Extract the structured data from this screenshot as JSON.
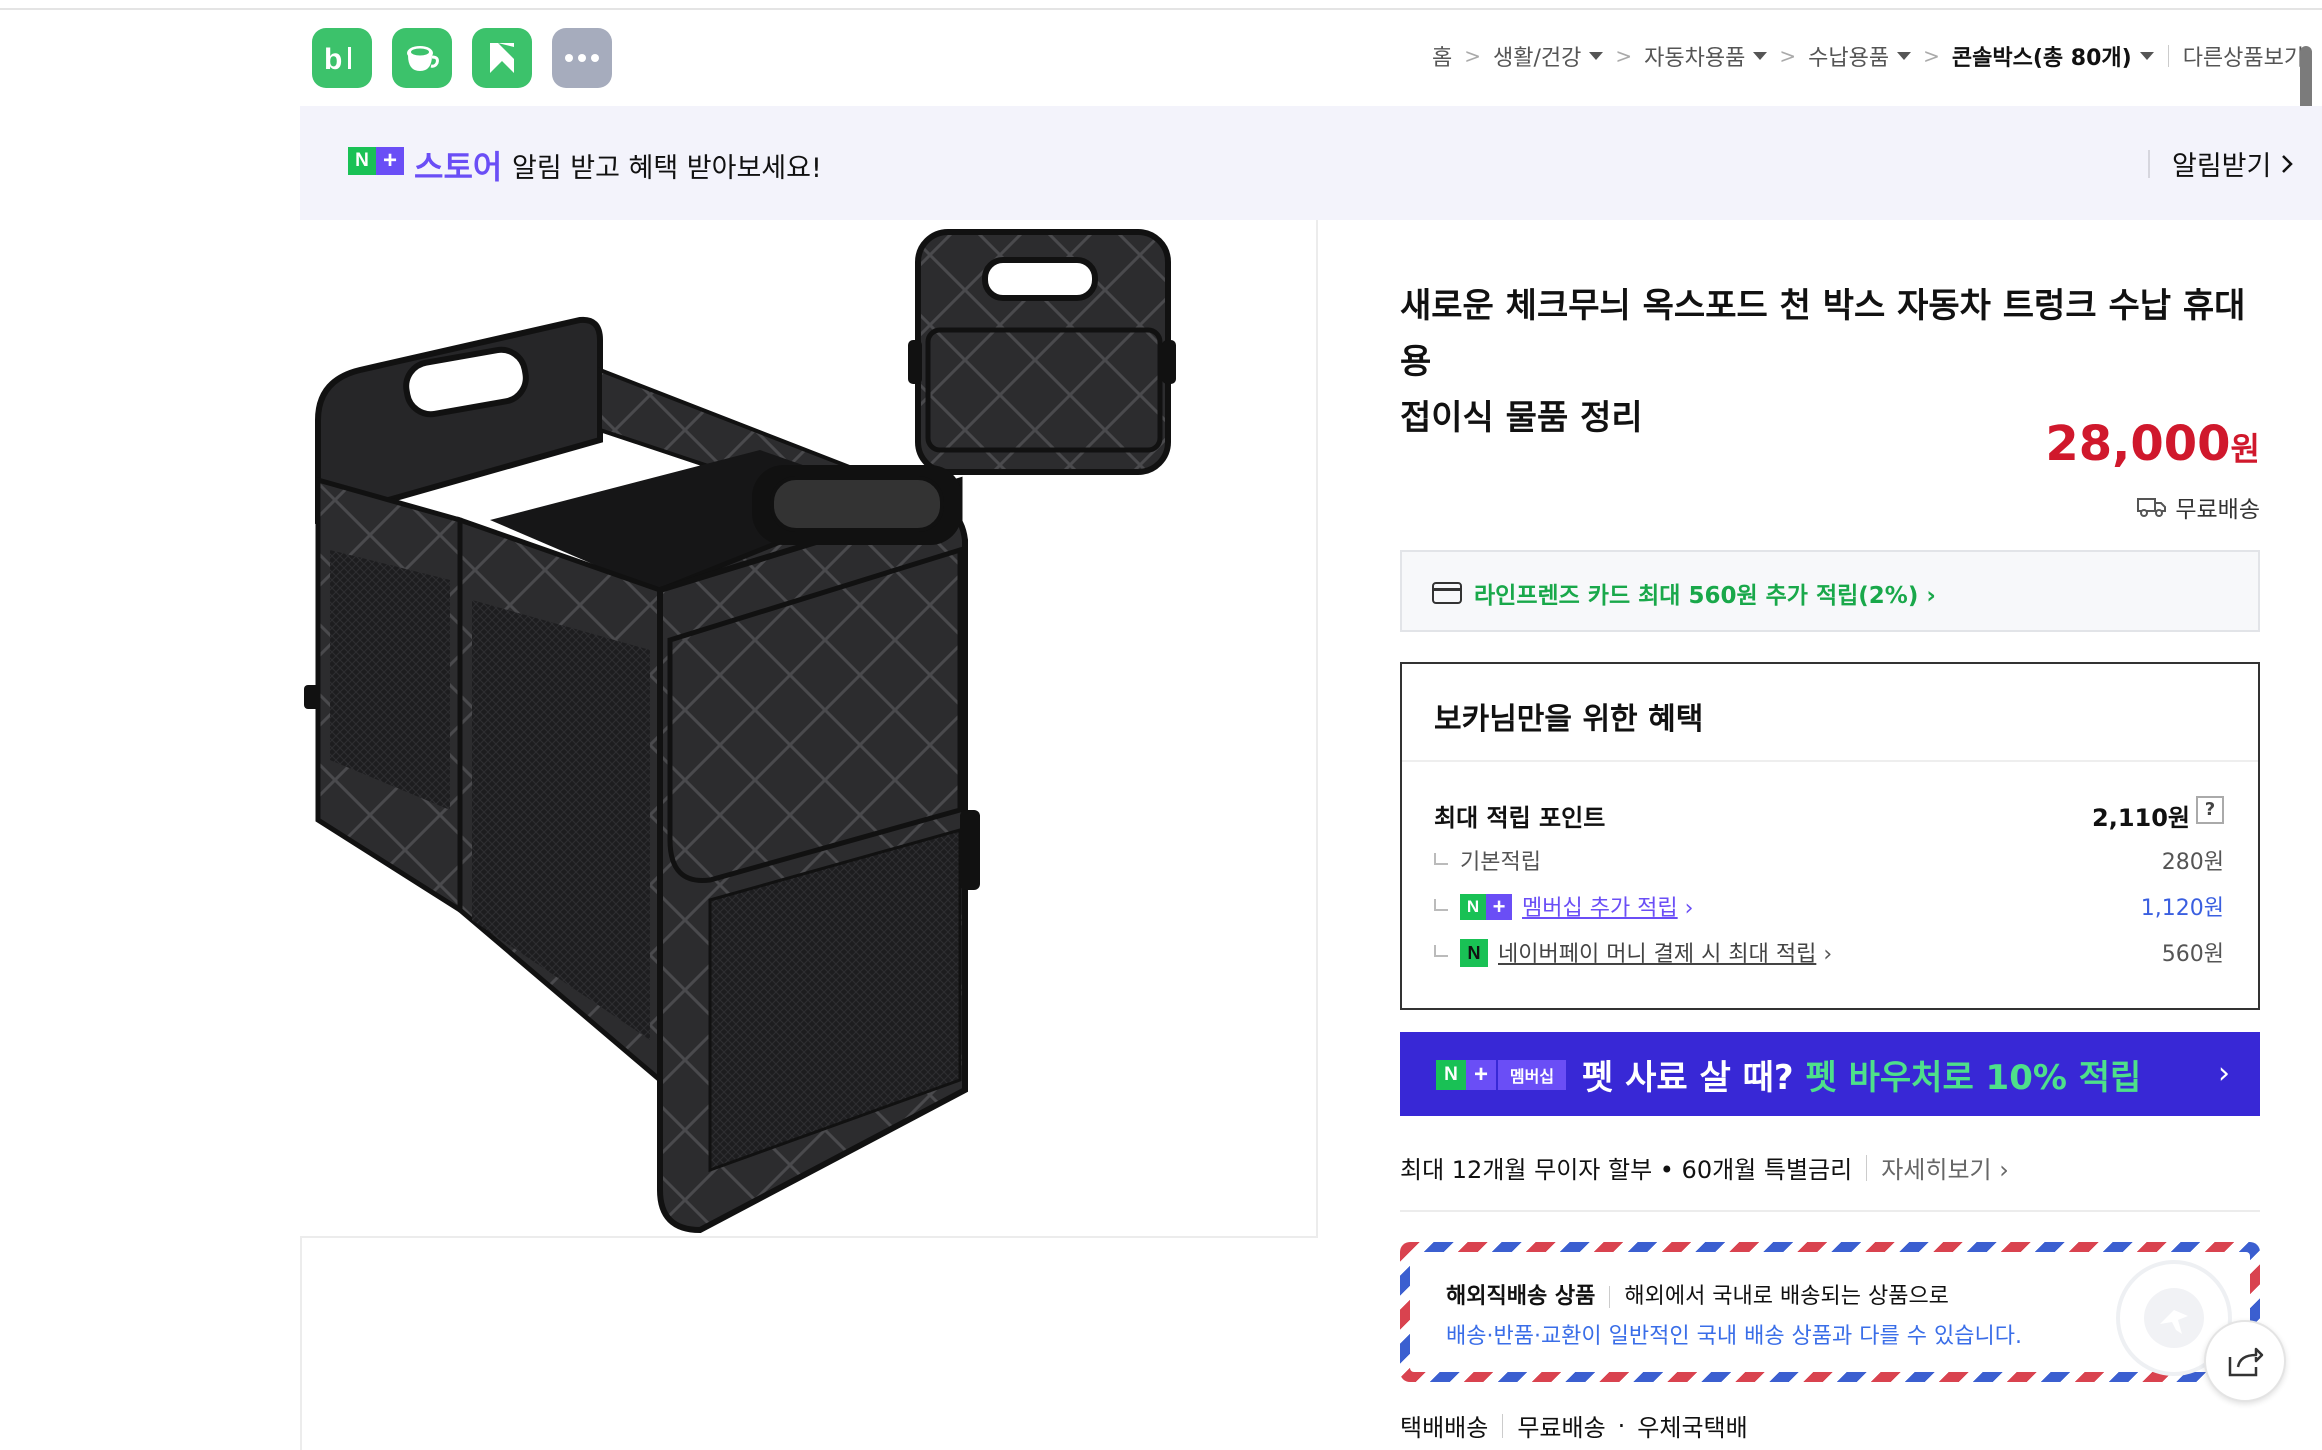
{
  "app_icons": [
    {
      "name": "blog-icon",
      "label": "b|"
    },
    {
      "name": "cafe-icon",
      "label": ""
    },
    {
      "name": "bookmark-icon",
      "label": ""
    },
    {
      "name": "more-icon",
      "label": "···"
    }
  ],
  "breadcrumb": {
    "home": "홈",
    "items": [
      "생활/건강",
      "자동차용품",
      "수납용품"
    ],
    "current": "콘솔박스(총 80개)",
    "other": "다른상품보기"
  },
  "banner": {
    "np_n": "N",
    "np_plus": "+",
    "store": "스토어",
    "message": "알림 받고 혜택 받아보세요!",
    "button": "알림받기"
  },
  "product": {
    "title_line1": "새로운 체크무늬 옥스포드 천 박스 자동차 트렁크 수납 휴대용",
    "title_line2": "접이식 물품 정리",
    "price": "28,000",
    "currency": "원",
    "shipping": "무료배송"
  },
  "card_benefit": "라인프렌즈 카드 최대 560원 추가 적립(2%)",
  "benefit": {
    "title": "보카님만을 위한 혜택",
    "max_label": "최대 적립 포인트",
    "max_value": "2,110원",
    "help": "?",
    "basic_label": "기본적립",
    "basic_value": "280원",
    "membership_label": "멤버십 추가 적립",
    "membership_value": "1,120원",
    "pay_label": "네이버페이 머니 결제 시 최대 적립",
    "pay_value": "560원"
  },
  "promo": {
    "badge_n": "N",
    "badge_plus": "+",
    "badge_membership": "멤버십",
    "text_main": "펫 사료 살 때? ",
    "text_highlight": "펫 바우처로 10% 적립",
    "arrow": "›"
  },
  "installment": {
    "text": "최대 12개월 무이자 할부 • 60개월 특별금리",
    "more": "자세히보기"
  },
  "overseas": {
    "title": "해외직배송 상품",
    "desc": "해외에서 국내로 배송되는 상품으로",
    "note": "배송·반품·교환이 일반적인 국내 배송 상품과 다를 수 있습니다."
  },
  "delivery": {
    "method": "택배배송",
    "fee": "무료배송",
    "carrier": "우체국택배"
  },
  "colors": {
    "price_red": "#d0182c",
    "naver_green": "#19c155",
    "plus_purple": "#6a4ef6",
    "promo_blue": "#3828d6"
  }
}
